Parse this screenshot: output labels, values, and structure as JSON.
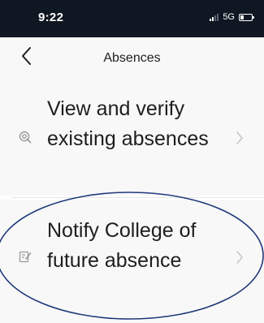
{
  "status_bar": {
    "time": "9:22",
    "network": "5G",
    "signal_icon": "cellular-signal-icon",
    "battery_icon": "battery-icon"
  },
  "nav": {
    "title": "Absences",
    "back_icon": "chevron-left-icon"
  },
  "items": [
    {
      "label": "View and verify existing absences",
      "icon": "verify-icon",
      "chevron": "chevron-right-icon"
    },
    {
      "label": "Notify College of future absence",
      "icon": "notify-edit-icon",
      "chevron": "chevron-right-icon"
    }
  ],
  "colors": {
    "status_bar_bg": "#0f1722",
    "background": "#f8f8f8",
    "text": "#1e1e1e",
    "icon": "#9a9a9a",
    "annotation": "#1f3a7a"
  }
}
